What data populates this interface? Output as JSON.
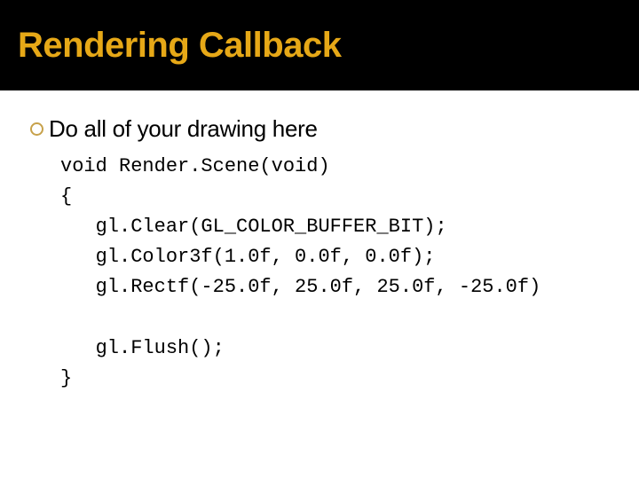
{
  "title": "Rendering Callback",
  "bullet": "Do all of your drawing here",
  "code": {
    "l1": "void Render.Scene(void)",
    "l2": "{",
    "l3": "   gl.Clear(GL_COLOR_BUFFER_BIT);",
    "l4": "   gl.Color3f(1.0f, 0.0f, 0.0f);",
    "l5": "   gl.Rectf(-25.0f, 25.0f, 25.0f, -25.0f)",
    "l6": "",
    "l7": "   gl.Flush();",
    "l8": "}"
  }
}
